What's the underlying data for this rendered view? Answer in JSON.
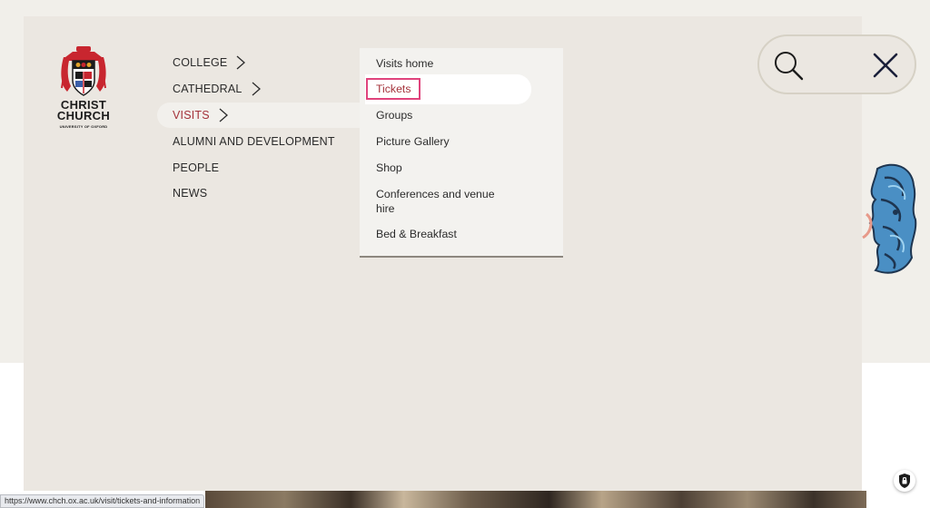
{
  "logo": {
    "name_line1": "CHRIST",
    "name_line2": "CHURCH",
    "subtitle": "UNIVERSITY OF OXFORD",
    "icon": "christ-church-crest"
  },
  "primary_nav": {
    "items": [
      {
        "label": "COLLEGE",
        "has_submenu": true,
        "active": false
      },
      {
        "label": "CATHEDRAL",
        "has_submenu": true,
        "active": false
      },
      {
        "label": "VISITS",
        "has_submenu": true,
        "active": true
      },
      {
        "label": "ALUMNI AND DEVELOPMENT",
        "has_submenu": false,
        "active": false
      },
      {
        "label": "PEOPLE",
        "has_submenu": false,
        "active": false
      },
      {
        "label": "NEWS",
        "has_submenu": false,
        "active": false
      }
    ]
  },
  "visits_submenu": {
    "items": [
      {
        "label": "Visits home"
      },
      {
        "label": "Tickets",
        "focused": true
      },
      {
        "label": "Groups"
      },
      {
        "label": "Picture Gallery"
      },
      {
        "label": "Shop"
      },
      {
        "label": "Conferences and venue hire"
      },
      {
        "label": "Bed & Breakfast"
      }
    ]
  },
  "utility": {
    "search_icon": "search-icon",
    "close_icon": "close-icon"
  },
  "status_bar": {
    "url": "https://www.chch.ox.ac.uk/visit/tickets-and-information"
  },
  "colors": {
    "accent_red": "#a4323a",
    "focus_pink": "#e0437c",
    "panel_bg": "#ebe7e1",
    "submenu_bg": "#f3f2ef"
  }
}
